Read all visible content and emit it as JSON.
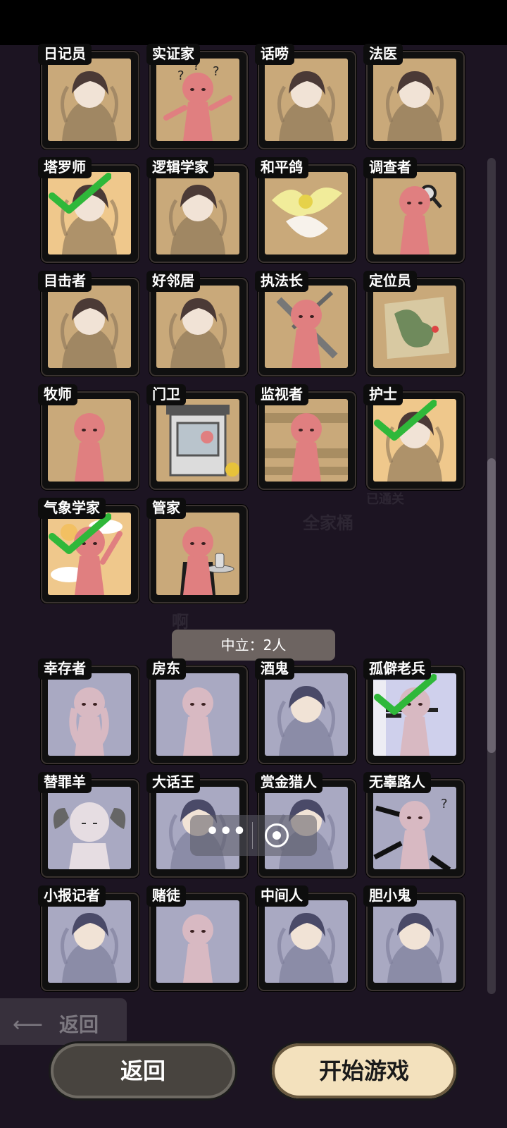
{
  "town_roles": [
    {
      "name": "日记员",
      "done": false,
      "art": "girl"
    },
    {
      "name": "实证家",
      "done": false,
      "art": "stick-question"
    },
    {
      "name": "话唠",
      "done": false,
      "art": "girl"
    },
    {
      "name": "法医",
      "done": false,
      "art": "girl"
    },
    {
      "name": "塔罗师",
      "done": true,
      "art": "girl"
    },
    {
      "name": "逻辑学家",
      "done": false,
      "art": "girl"
    },
    {
      "name": "和平鸽",
      "done": false,
      "art": "bird"
    },
    {
      "name": "调查者",
      "done": false,
      "art": "stick-magnifier"
    },
    {
      "name": "目击者",
      "done": false,
      "art": "girl"
    },
    {
      "name": "好邻居",
      "done": false,
      "art": "girl"
    },
    {
      "name": "执法长",
      "done": false,
      "art": "stick-sword"
    },
    {
      "name": "定位员",
      "done": false,
      "art": "map"
    },
    {
      "name": "牧师",
      "done": false,
      "art": "stick-pray"
    },
    {
      "name": "门卫",
      "done": false,
      "art": "booth"
    },
    {
      "name": "监视者",
      "done": false,
      "art": "stick-peek"
    },
    {
      "name": "护士",
      "done": true,
      "art": "girl"
    },
    {
      "name": "气象学家",
      "done": true,
      "art": "stick-weather"
    },
    {
      "name": "管家",
      "done": false,
      "art": "stick-butler"
    }
  ],
  "neutral_header": "中立：2人",
  "neutral_roles": [
    {
      "name": "幸存者",
      "done": false,
      "art": "stick-crouch"
    },
    {
      "name": "房东",
      "done": false,
      "art": "stick-plain"
    },
    {
      "name": "酒鬼",
      "done": false,
      "art": "girl"
    },
    {
      "name": "孤僻老兵",
      "done": true,
      "art": "stick-gun"
    },
    {
      "name": "替罪羊",
      "done": false,
      "art": "goat"
    },
    {
      "name": "大话王",
      "done": false,
      "art": "girl"
    },
    {
      "name": "赏金猎人",
      "done": false,
      "art": "girl"
    },
    {
      "name": "无辜路人",
      "done": false,
      "art": "stick-gunpoint"
    },
    {
      "name": "小报记者",
      "done": false,
      "art": "girl"
    },
    {
      "name": "赌徒",
      "done": false,
      "art": "stick-plain"
    },
    {
      "name": "中间人",
      "done": false,
      "art": "girl"
    },
    {
      "name": "胆小鬼",
      "done": false,
      "art": "girl"
    }
  ],
  "background_text": [
    "已通关",
    "全家桶",
    "啊",
    "返回"
  ],
  "buttons": {
    "back": "返回",
    "start": "开始游戏"
  },
  "colors": {
    "check": "#2fb83a",
    "stick_town": "#e07f80",
    "stick_neutral": "#d8b9c2"
  }
}
